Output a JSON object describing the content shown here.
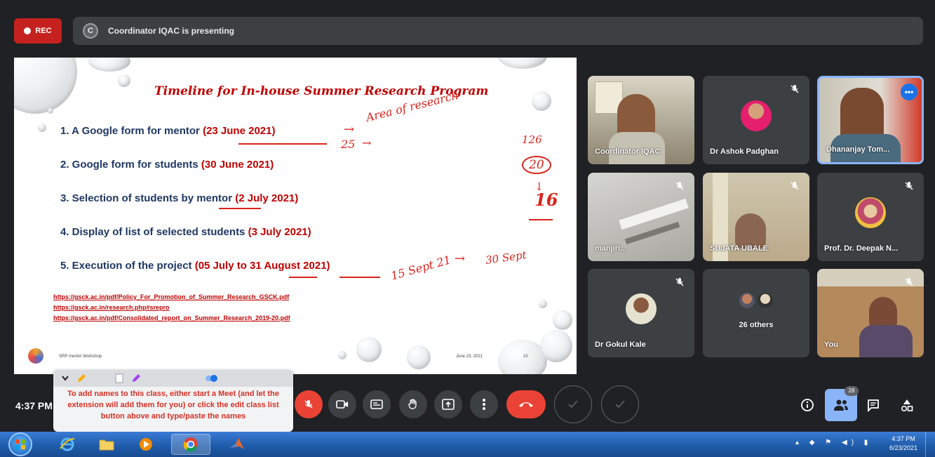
{
  "recording": {
    "label": "REC"
  },
  "presenter": {
    "initial": "C",
    "text": "Coordinator IQAC is presenting"
  },
  "slide": {
    "title": "Timeline for In-house Summer Research Program",
    "items": [
      {
        "text": "1. A Google form  for mentor ",
        "date": "(23 June 2021)"
      },
      {
        "text": "2. Google form for students ",
        "date": "(30 June 2021)"
      },
      {
        "text": "3. Selection of students by mentor ",
        "date": "(2 July 2021)"
      },
      {
        "text": "4. Display of list of selected students ",
        "date": "(3 July 2021)"
      },
      {
        "text": "5. Execution of the project ",
        "date": "(05 July to 31 August 2021)"
      }
    ],
    "links": [
      "https://gsck.ac.in/pdf/Policy_For_Promotion_of_Summer_Research_GSCK.pdf",
      "https://gsck.ac.in/research.php#srepro",
      "https://gsck.ac.in/pdf/Consolidated_report_on_Summer_Research_2019-20.pdf"
    ],
    "footer_left": "SRP mentor Workshop",
    "footer_date": "June 23, 2021",
    "footer_num": "10",
    "annotations": {
      "area": "Area of research",
      "count25": "25",
      "n126": "126",
      "n20": "20",
      "n16": "16",
      "sept15": "15 Sept 21",
      "sept30": "30 Sept"
    }
  },
  "participants": [
    {
      "name": "Coordinator IQAC",
      "muted": false
    },
    {
      "name": "Dr Ashok Padghan",
      "muted": true
    },
    {
      "name": "Dhananjay Tom...",
      "muted": false,
      "active": true
    },
    {
      "name": "manjiri...",
      "muted": true
    },
    {
      "name": "SUJATA UBALE",
      "muted": true
    },
    {
      "name": "Prof. Dr. Deepak N...",
      "muted": true
    },
    {
      "name": "Dr Gokul Kale",
      "muted": true
    },
    {
      "name": "26 others",
      "muted": false
    },
    {
      "name": "You",
      "muted": true
    }
  ],
  "controls": {
    "time": "4:37 PM",
    "people_count": "28"
  },
  "tooltip": {
    "text": "To add names to this class, either start a Meet (and let the extension will add them for you) or click the edit class list button above and type/paste the names"
  },
  "taskbar": {
    "time": "4:37 PM",
    "date": "6/23/2021"
  },
  "colors": {
    "meet_bg": "#202124",
    "tile_bg": "#3c4043",
    "rec_red": "#c5221f",
    "end_call_red": "#ea4335",
    "slide_red": "#c00000",
    "slide_blue": "#1f3864",
    "people_active": "#8ab4f8"
  }
}
